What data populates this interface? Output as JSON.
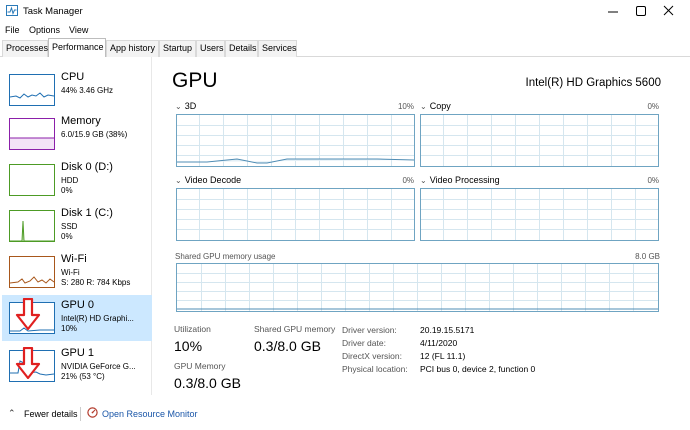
{
  "window": {
    "title": "Task Manager",
    "icon": "task-manager-icon",
    "controls": [
      "minimize-icon",
      "maximize-icon",
      "close-icon"
    ]
  },
  "menu": {
    "file": "File",
    "options": "Options",
    "view": "View"
  },
  "tabs": [
    {
      "label": "Processes",
      "active": false
    },
    {
      "label": "Performance",
      "active": true
    },
    {
      "label": "App history",
      "active": false
    },
    {
      "label": "Startup",
      "active": false
    },
    {
      "label": "Users",
      "active": false
    },
    {
      "label": "Details",
      "active": false
    },
    {
      "label": "Services",
      "active": false
    }
  ],
  "sidebar": {
    "items": [
      {
        "title": "CPU",
        "line1": "44% 3.46 GHz",
        "line2": "",
        "color": "#1f6fb2"
      },
      {
        "title": "Memory",
        "line1": "6.0/15.9 GB (38%)",
        "line2": "",
        "color": "#8b1fa9"
      },
      {
        "title": "Disk 0 (D:)",
        "line1": "HDD",
        "line2": "0%",
        "color": "#4d9b25"
      },
      {
        "title": "Disk 1 (C:)",
        "line1": "SSD",
        "line2": "0%",
        "color": "#4d9b25"
      },
      {
        "title": "Wi-Fi",
        "line1": "Wi-Fi",
        "line2": "S: 280  R: 784 Kbps",
        "color": "#a8571b"
      },
      {
        "title": "GPU 0",
        "line1": "Intel(R) HD Graphi...",
        "line2": "10%",
        "color": "#1f6fb2",
        "selected": true
      },
      {
        "title": "GPU 1",
        "line1": "NVIDIA GeForce G...",
        "line2": "21% (53 °C)",
        "color": "#1f6fb2"
      }
    ],
    "annotation_color": "#e02020"
  },
  "main": {
    "title": "GPU",
    "model": "Intel(R) HD Graphics 5600",
    "graphs": [
      {
        "label": "3D",
        "percent": "10%"
      },
      {
        "label": "Copy",
        "percent": "0%"
      },
      {
        "label": "Video Decode",
        "percent": "0%"
      },
      {
        "label": "Video Processing",
        "percent": "0%"
      }
    ],
    "shared_memory_graph": {
      "label": "Shared GPU memory usage",
      "max": "8.0 GB"
    },
    "stats": {
      "utilization_label": "Utilization",
      "utilization_value": "10%",
      "shared_mem_label": "Shared GPU memory",
      "shared_mem_value": "0.3/8.0 GB",
      "gpu_mem_label": "GPU Memory",
      "gpu_mem_value": "0.3/8.0 GB"
    },
    "info": [
      {
        "key": "Driver version:",
        "value": "20.19.15.5171"
      },
      {
        "key": "Driver date:",
        "value": "4/11/2020"
      },
      {
        "key": "DirectX version:",
        "value": "12 (FL 11.1)"
      },
      {
        "key": "Physical location:",
        "value": "PCI bus 0, device 2, function 0"
      }
    ],
    "accent": "#6fa4c2"
  },
  "footer": {
    "fewer_details": "Fewer details",
    "open_resource_monitor": "Open Resource Monitor"
  }
}
